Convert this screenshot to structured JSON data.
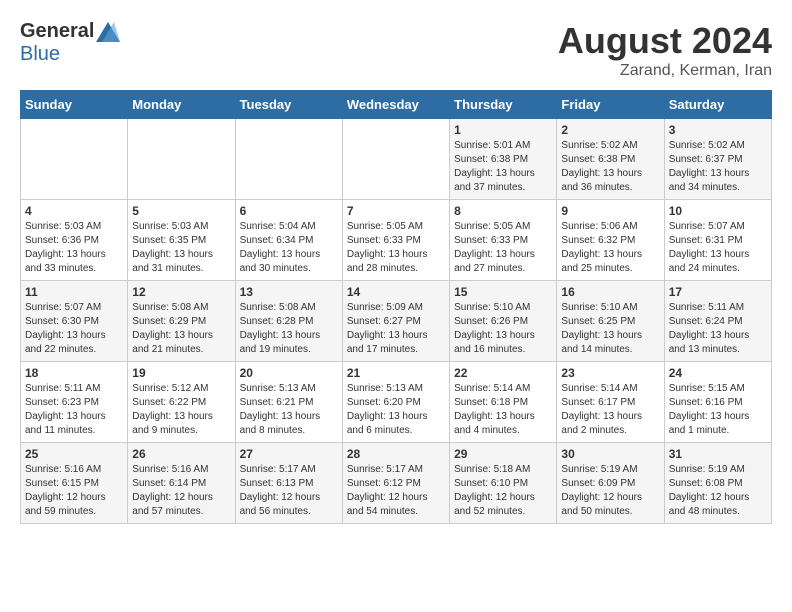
{
  "header": {
    "logo_general": "General",
    "logo_blue": "Blue",
    "month_year": "August 2024",
    "location": "Zarand, Kerman, Iran"
  },
  "weekdays": [
    "Sunday",
    "Monday",
    "Tuesday",
    "Wednesday",
    "Thursday",
    "Friday",
    "Saturday"
  ],
  "weeks": [
    [
      {
        "day": "",
        "info": ""
      },
      {
        "day": "",
        "info": ""
      },
      {
        "day": "",
        "info": ""
      },
      {
        "day": "",
        "info": ""
      },
      {
        "day": "1",
        "info": "Sunrise: 5:01 AM\nSunset: 6:38 PM\nDaylight: 13 hours\nand 37 minutes."
      },
      {
        "day": "2",
        "info": "Sunrise: 5:02 AM\nSunset: 6:38 PM\nDaylight: 13 hours\nand 36 minutes."
      },
      {
        "day": "3",
        "info": "Sunrise: 5:02 AM\nSunset: 6:37 PM\nDaylight: 13 hours\nand 34 minutes."
      }
    ],
    [
      {
        "day": "4",
        "info": "Sunrise: 5:03 AM\nSunset: 6:36 PM\nDaylight: 13 hours\nand 33 minutes."
      },
      {
        "day": "5",
        "info": "Sunrise: 5:03 AM\nSunset: 6:35 PM\nDaylight: 13 hours\nand 31 minutes."
      },
      {
        "day": "6",
        "info": "Sunrise: 5:04 AM\nSunset: 6:34 PM\nDaylight: 13 hours\nand 30 minutes."
      },
      {
        "day": "7",
        "info": "Sunrise: 5:05 AM\nSunset: 6:33 PM\nDaylight: 13 hours\nand 28 minutes."
      },
      {
        "day": "8",
        "info": "Sunrise: 5:05 AM\nSunset: 6:33 PM\nDaylight: 13 hours\nand 27 minutes."
      },
      {
        "day": "9",
        "info": "Sunrise: 5:06 AM\nSunset: 6:32 PM\nDaylight: 13 hours\nand 25 minutes."
      },
      {
        "day": "10",
        "info": "Sunrise: 5:07 AM\nSunset: 6:31 PM\nDaylight: 13 hours\nand 24 minutes."
      }
    ],
    [
      {
        "day": "11",
        "info": "Sunrise: 5:07 AM\nSunset: 6:30 PM\nDaylight: 13 hours\nand 22 minutes."
      },
      {
        "day": "12",
        "info": "Sunrise: 5:08 AM\nSunset: 6:29 PM\nDaylight: 13 hours\nand 21 minutes."
      },
      {
        "day": "13",
        "info": "Sunrise: 5:08 AM\nSunset: 6:28 PM\nDaylight: 13 hours\nand 19 minutes."
      },
      {
        "day": "14",
        "info": "Sunrise: 5:09 AM\nSunset: 6:27 PM\nDaylight: 13 hours\nand 17 minutes."
      },
      {
        "day": "15",
        "info": "Sunrise: 5:10 AM\nSunset: 6:26 PM\nDaylight: 13 hours\nand 16 minutes."
      },
      {
        "day": "16",
        "info": "Sunrise: 5:10 AM\nSunset: 6:25 PM\nDaylight: 13 hours\nand 14 minutes."
      },
      {
        "day": "17",
        "info": "Sunrise: 5:11 AM\nSunset: 6:24 PM\nDaylight: 13 hours\nand 13 minutes."
      }
    ],
    [
      {
        "day": "18",
        "info": "Sunrise: 5:11 AM\nSunset: 6:23 PM\nDaylight: 13 hours\nand 11 minutes."
      },
      {
        "day": "19",
        "info": "Sunrise: 5:12 AM\nSunset: 6:22 PM\nDaylight: 13 hours\nand 9 minutes."
      },
      {
        "day": "20",
        "info": "Sunrise: 5:13 AM\nSunset: 6:21 PM\nDaylight: 13 hours\nand 8 minutes."
      },
      {
        "day": "21",
        "info": "Sunrise: 5:13 AM\nSunset: 6:20 PM\nDaylight: 13 hours\nand 6 minutes."
      },
      {
        "day": "22",
        "info": "Sunrise: 5:14 AM\nSunset: 6:18 PM\nDaylight: 13 hours\nand 4 minutes."
      },
      {
        "day": "23",
        "info": "Sunrise: 5:14 AM\nSunset: 6:17 PM\nDaylight: 13 hours\nand 2 minutes."
      },
      {
        "day": "24",
        "info": "Sunrise: 5:15 AM\nSunset: 6:16 PM\nDaylight: 13 hours\nand 1 minute."
      }
    ],
    [
      {
        "day": "25",
        "info": "Sunrise: 5:16 AM\nSunset: 6:15 PM\nDaylight: 12 hours\nand 59 minutes."
      },
      {
        "day": "26",
        "info": "Sunrise: 5:16 AM\nSunset: 6:14 PM\nDaylight: 12 hours\nand 57 minutes."
      },
      {
        "day": "27",
        "info": "Sunrise: 5:17 AM\nSunset: 6:13 PM\nDaylight: 12 hours\nand 56 minutes."
      },
      {
        "day": "28",
        "info": "Sunrise: 5:17 AM\nSunset: 6:12 PM\nDaylight: 12 hours\nand 54 minutes."
      },
      {
        "day": "29",
        "info": "Sunrise: 5:18 AM\nSunset: 6:10 PM\nDaylight: 12 hours\nand 52 minutes."
      },
      {
        "day": "30",
        "info": "Sunrise: 5:19 AM\nSunset: 6:09 PM\nDaylight: 12 hours\nand 50 minutes."
      },
      {
        "day": "31",
        "info": "Sunrise: 5:19 AM\nSunset: 6:08 PM\nDaylight: 12 hours\nand 48 minutes."
      }
    ]
  ]
}
